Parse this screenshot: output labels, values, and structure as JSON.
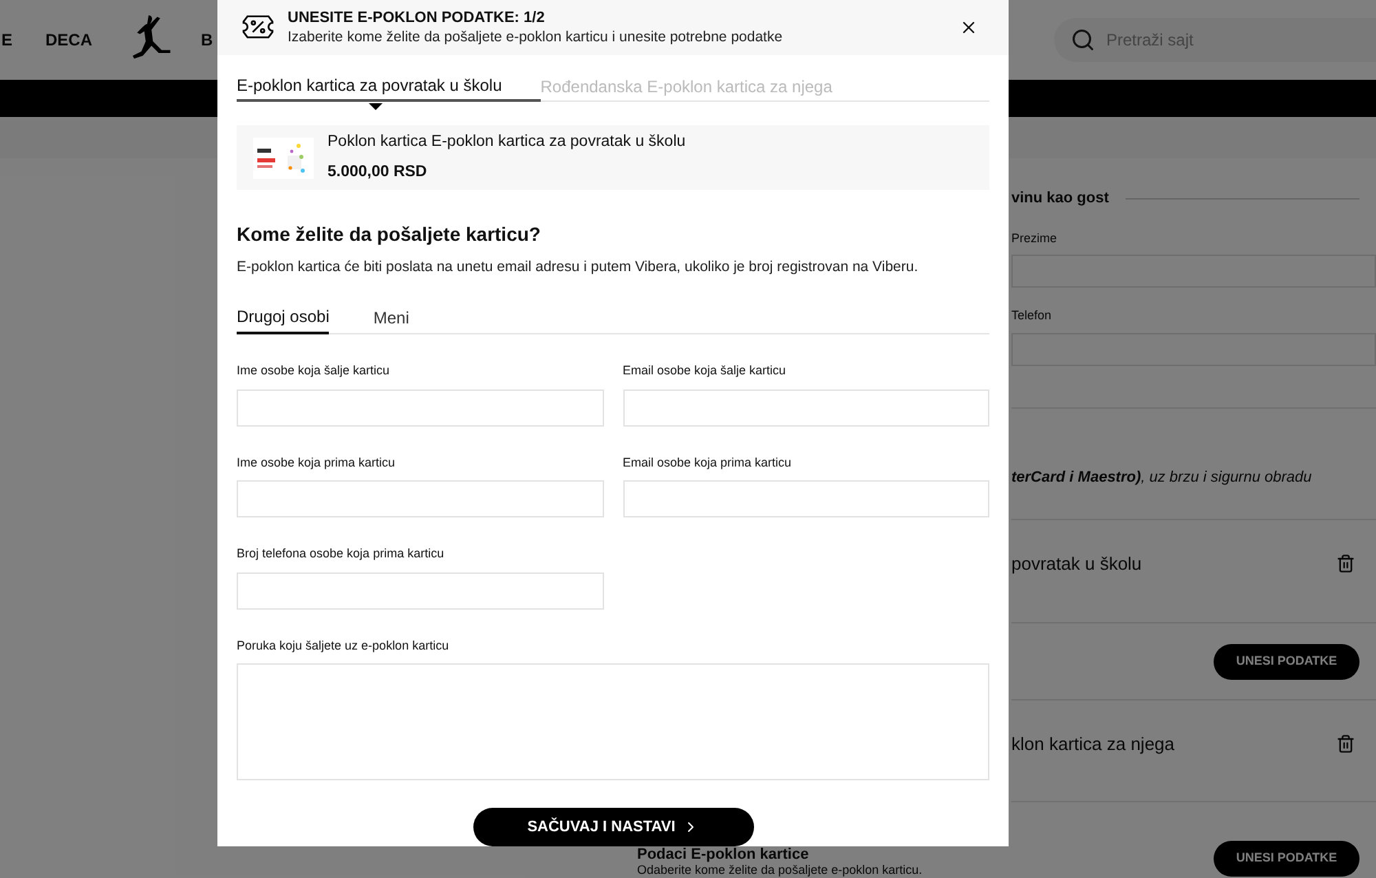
{
  "background": {
    "nav_items": [
      "E",
      "DECA",
      "B"
    ],
    "search": {
      "placeholder": "Pretraži sajt"
    },
    "guest_heading": "vinu kao gost",
    "field_labels": [
      "Prezime",
      "Telefon"
    ],
    "payment_note": "**terCard i Maestro)**, uz brzu i sigurnu obradu",
    "cart_items": [
      {
        "name": "povratak u školu",
        "button": "UNESI PODATKE"
      },
      {
        "name": "klon kartica za njega",
        "button": "UNESI PODATKE"
      }
    ],
    "details": {
      "title": "Podaci E-poklon kartice",
      "text": "Odaberite kome želite da pošaljete e-poklon karticu."
    }
  },
  "modal": {
    "title": "UNESITE E-POKLON PODATKE: 1/2",
    "subtitle": "Izaberite kome želite da pošaljete e-poklon karticu i unesite potrebne podatke",
    "tabs": [
      {
        "label": "E-poklon kartica za povratak u školu",
        "selected": true
      },
      {
        "label": "Rođendanska E-poklon kartica za njega",
        "selected": false
      }
    ],
    "product": {
      "kind": "picture",
      "name": "Poklon kartica E-poklon kartica za povratak u školu",
      "price": "5.000,00 RSD"
    },
    "question": "Kome želite da pošaljete karticu?",
    "info": "E-poklon kartica će biti poslata na unetu email adresu i putem Vibera, ukoliko je broj registrovan na Viberu.",
    "recipient_tabs": [
      {
        "label": "Drugoj osobi",
        "selected": true
      },
      {
        "label": "Meni",
        "selected": false
      }
    ],
    "fields": [
      {
        "kind": "input",
        "label": "Ime osobe koja šalje karticu"
      },
      {
        "kind": "input",
        "label": "Email osobe koja šalje karticu"
      },
      {
        "kind": "input",
        "label": "Ime osobe koja prima karticu"
      },
      {
        "kind": "input",
        "label": "Email osobe koja prima karticu"
      },
      {
        "kind": "input",
        "label": "Broj telefona osobe koja prima karticu"
      },
      {
        "kind": "textarea",
        "label": "Poruka koju šaljete uz e-poklon karticu"
      }
    ],
    "submit": "SAČUVAJ I NASTAVI"
  }
}
